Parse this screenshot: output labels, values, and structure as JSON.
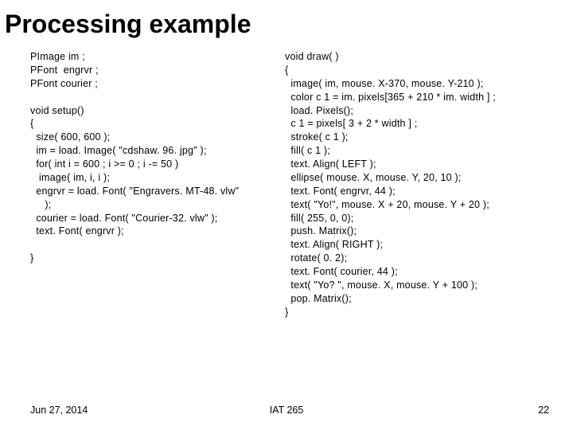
{
  "title": "Processing example",
  "left_code": [
    "PImage im ;",
    "PFont  engrvr ;",
    "PFont courier ;",
    "",
    "void setup()",
    "{",
    "  size( 600, 600 );",
    "  im = load. Image( \"cdshaw. 96. jpg\" );",
    "  for( int i = 600 ; i >= 0 ; i -= 50 )",
    "   image( im, i, i );",
    "  engrvr = load. Font( \"Engravers. MT-48. vlw\"",
    "     );",
    "  courier = load. Font( \"Courier-32. vlw\" );",
    "  text. Font( engrvr );",
    "",
    "}"
  ],
  "right_code": [
    "void draw( )",
    "{",
    "  image( im, mouse. X-370, mouse. Y-210 );",
    "  color c 1 = im. pixels[365 + 210 * im. width ] ;",
    "  load. Pixels();",
    "  c 1 = pixels[ 3 + 2 * width ] ;",
    "  stroke( c 1 );",
    "  fill( c 1 );",
    "  text. Align( LEFT );",
    "  ellipse( mouse. X, mouse. Y, 20, 10 );",
    "  text. Font( engrvr, 44 );",
    "  text( \"Yo!\", mouse. X + 20, mouse. Y + 20 );",
    "  fill( 255, 0, 0);",
    "  push. Matrix();",
    "  text. Align( RIGHT );",
    "  rotate( 0. 2);",
    "  text. Font( courier, 44 );",
    "  text( \"Yo? \", mouse. X, mouse. Y + 100 );",
    "  pop. Matrix();",
    "}"
  ],
  "footer": {
    "date": "Jun 27, 2014",
    "course": "IAT 265",
    "page": "22"
  }
}
